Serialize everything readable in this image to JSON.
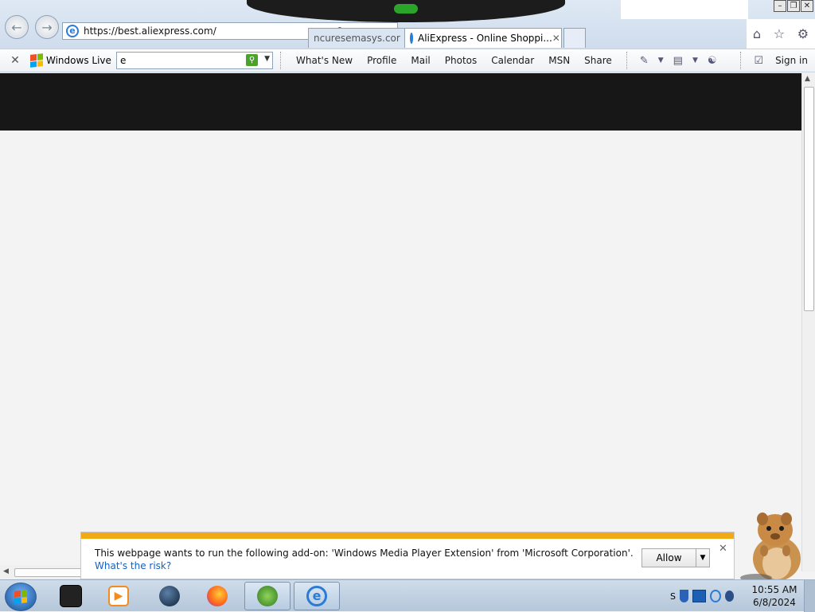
{
  "browser": {
    "address_url": "https://best.aliexpress.com/",
    "tabs": [
      {
        "label": "ncuresemasys.cor",
        "active": false
      },
      {
        "label": "AliExpress - Online Shoppi...",
        "active": true
      }
    ]
  },
  "toolbar": {
    "brand": "Windows Live",
    "search_value": "e",
    "links": [
      "What's New",
      "Profile",
      "Mail",
      "Photos",
      "Calendar",
      "MSN",
      "Share"
    ],
    "sign_in": "Sign in"
  },
  "info_bar": {
    "message": "This webpage wants to run the following add-on: 'Windows Media Player Extension' from 'Microsoft Corporation'.",
    "risk_link": "What's the risk?",
    "allow_label": "Allow"
  },
  "taskbar": {
    "time": "10:55 AM",
    "date": "6/8/2024"
  },
  "colors": {
    "header_band": "#171717",
    "info_stripe": "#efaa16",
    "link_blue": "#1560c2"
  }
}
